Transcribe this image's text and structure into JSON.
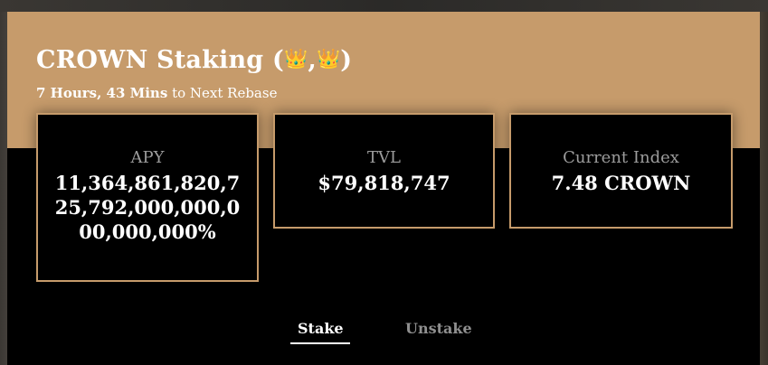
{
  "header": {
    "title": "CROWN Staking (",
    "title_sep": ",",
    "title_end": ")",
    "title_icons": [
      "crown-emoji",
      "crown-emoji"
    ],
    "rebase_time": "7 Hours, 43 Mins",
    "rebase_suffix": " to Next Rebase"
  },
  "stats": [
    {
      "label": "APY",
      "value": "11,364,861,820,725,792,000,000,000,000,000%"
    },
    {
      "label": "TVL",
      "value": "$79,818,747"
    },
    {
      "label": "Current Index",
      "value": "7.48 CROWN"
    }
  ],
  "tabs": [
    {
      "label": "Stake",
      "active": true
    },
    {
      "label": "Unstake",
      "active": false
    }
  ],
  "colors": {
    "accent": "#c69b6b",
    "card_bg": "#000000",
    "label_gray": "#9c9c9c",
    "inactive_tab": "#8f8f8f"
  }
}
